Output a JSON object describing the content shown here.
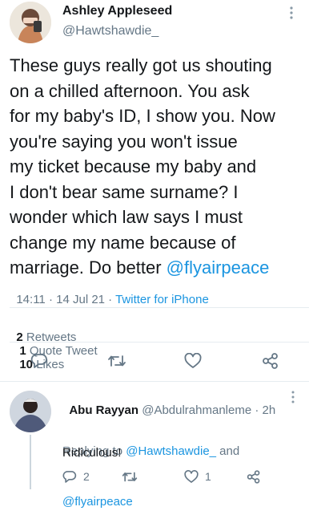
{
  "tweet": {
    "author_name": "Ashley Appleseed",
    "author_handle": "@Hawtshawdie_",
    "text_lines": [
      "These guys really got us shouting",
      "on a chilled afternoon. You ask",
      "for my baby's ID, I show you. Now",
      "you're saying you won't issue",
      "my ticket because my baby and",
      "I don't bear same surname? I",
      "wonder which law says I must",
      "change my name because of"
    ],
    "last_line_text": "marriage. Do better ",
    "mention": "@flyairpeace",
    "time": "14:11",
    "date_sep": " · ",
    "date": "14 Jul 21",
    "source_sep": " · ",
    "source": "Twitter for iPhone",
    "stats": {
      "retweets_count": "2",
      "retweets_label": "Retweets",
      "quotes_count": "1",
      "quotes_label": "Quote Tweet",
      "likes_count": "10",
      "likes_label": "Likes"
    },
    "icons": [
      "reply-icon",
      "retweet-icon",
      "like-icon",
      "share-icon",
      "more-icon"
    ]
  },
  "reply": {
    "author_name": "Abu Rayyan",
    "author_handle": "@Abdulrahmanleme",
    "time_sep": " · ",
    "time": "2h",
    "replying_to_label": "Replying to ",
    "replying_to_user1": "@Hawtshawdie_",
    "replying_and": " and",
    "replying_to_user2": "@flyairpeace",
    "text": "Ridiculous!",
    "reply_count": "2",
    "retweet_count": "",
    "like_count": "1"
  },
  "colors": {
    "link": "#1b95e0",
    "muted": "#657786",
    "text": "#14171a",
    "divider": "#e6ecf0"
  }
}
